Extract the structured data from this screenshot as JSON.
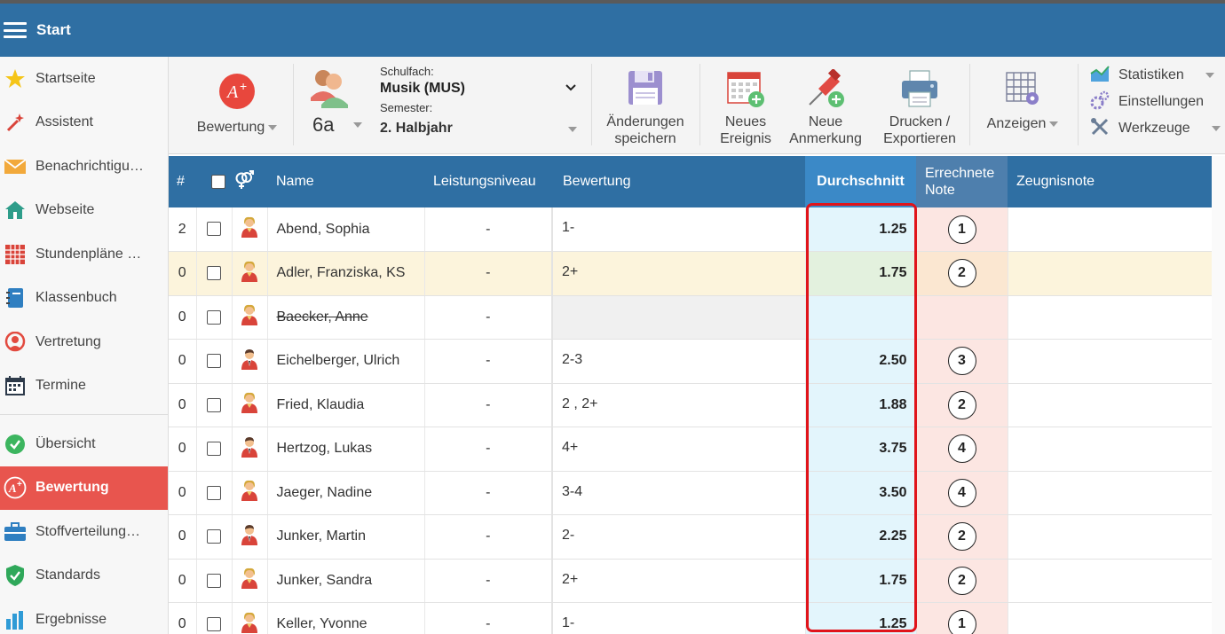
{
  "topbar": {
    "title": "Start"
  },
  "sidebar": {
    "items": [
      {
        "label": "Startseite",
        "icon": "star-icon"
      },
      {
        "label": "Assistent",
        "icon": "magic-wand-icon"
      },
      {
        "label": "Benachrichtigu…",
        "icon": "envelope-icon"
      },
      {
        "label": "Webseite",
        "icon": "home-icon"
      },
      {
        "label": "Stundenpläne …",
        "icon": "timetable-icon"
      },
      {
        "label": "Klassenbuch",
        "icon": "notebook-icon"
      },
      {
        "label": "Vertretung",
        "icon": "substitute-person-icon"
      },
      {
        "label": "Termine",
        "icon": "calendar-icon"
      },
      {
        "label": "Übersicht",
        "icon": "check-circle-icon"
      },
      {
        "label": "Bewertung",
        "icon": "grade-icon",
        "active": true
      },
      {
        "label": "Stoffverteilung…",
        "icon": "briefcase-icon"
      },
      {
        "label": "Standards",
        "icon": "shield-check-icon"
      },
      {
        "label": "Ergebnisse",
        "icon": "bar-chart-icon"
      }
    ]
  },
  "toolbar": {
    "bewertung_label": "Bewertung",
    "class_label": "6a",
    "schulfach_caption": "Schulfach:",
    "schulfach_value": "Musik (MUS)",
    "semester_caption": "Semester:",
    "semester_value": "2. Halbjahr",
    "save_line1": "Änderungen",
    "save_line2": "speichern",
    "event_line1": "Neues",
    "event_line2": "Ereignis",
    "note_line1": "Neue",
    "note_line2": "Anmerkung",
    "print_line1": "Drucken /",
    "print_line2": "Exportieren",
    "show_label": "Anzeigen",
    "statistiken": "Statistiken",
    "einstellungen": "Einstellungen",
    "werkzeuge": "Werkzeuge"
  },
  "table": {
    "headers": {
      "num": "#",
      "name": "Name",
      "niveau": "Leistungsniveau",
      "bewertung": "Bewertung",
      "avg": "Durchschnitt",
      "calc_line1": "Errechnete",
      "calc_line2": "Note",
      "zeugnis": "Zeugnisnote"
    },
    "rows": [
      {
        "num": "2",
        "gender": "female",
        "name": "Abend, Sophia",
        "niveau": "-",
        "rating": "1-",
        "avg": "1.25",
        "note": "1",
        "zeugnis": ""
      },
      {
        "num": "0",
        "gender": "female",
        "name": "Adler, Franziska, KS",
        "niveau": "-",
        "rating": "2+",
        "avg": "1.75",
        "note": "2",
        "zeugnis": "",
        "highlight": true
      },
      {
        "num": "0",
        "gender": "female",
        "name": "Baecker, Anne",
        "niveau": "-",
        "rating": "",
        "avg": "",
        "note": "",
        "zeugnis": "",
        "struck": true
      },
      {
        "num": "0",
        "gender": "male",
        "name": "Eichelberger, Ulrich",
        "niveau": "-",
        "rating": "2-3",
        "avg": "2.50",
        "note": "3",
        "zeugnis": ""
      },
      {
        "num": "0",
        "gender": "female",
        "name": "Fried, Klaudia",
        "niveau": "-",
        "rating": "2 ,  2+",
        "avg": "1.88",
        "note": "2",
        "zeugnis": ""
      },
      {
        "num": "0",
        "gender": "male",
        "name": "Hertzog, Lukas",
        "niveau": "-",
        "rating": "4+",
        "avg": "3.75",
        "note": "4",
        "zeugnis": ""
      },
      {
        "num": "0",
        "gender": "female",
        "name": "Jaeger, Nadine",
        "niveau": "-",
        "rating": "3-4",
        "avg": "3.50",
        "note": "4",
        "zeugnis": ""
      },
      {
        "num": "0",
        "gender": "male",
        "name": "Junker, Martin",
        "niveau": "-",
        "rating": "2-",
        "avg": "2.25",
        "note": "2",
        "zeugnis": ""
      },
      {
        "num": "0",
        "gender": "female",
        "name": "Junker, Sandra",
        "niveau": "-",
        "rating": "2+",
        "avg": "1.75",
        "note": "2",
        "zeugnis": ""
      },
      {
        "num": "0",
        "gender": "female",
        "name": "Keller, Yvonne",
        "niveau": "-",
        "rating": "1-",
        "avg": "1.25",
        "note": "1",
        "zeugnis": ""
      }
    ]
  },
  "colors": {
    "brand": "#2f6fa3",
    "active": "#e8554e",
    "avg_header": "#3b89c7",
    "avg_cell": "#e3f5fc",
    "note_cell": "#fce6e2",
    "highlight_row": "#fcf4dc",
    "emphasis_frame": "#e0141b"
  }
}
